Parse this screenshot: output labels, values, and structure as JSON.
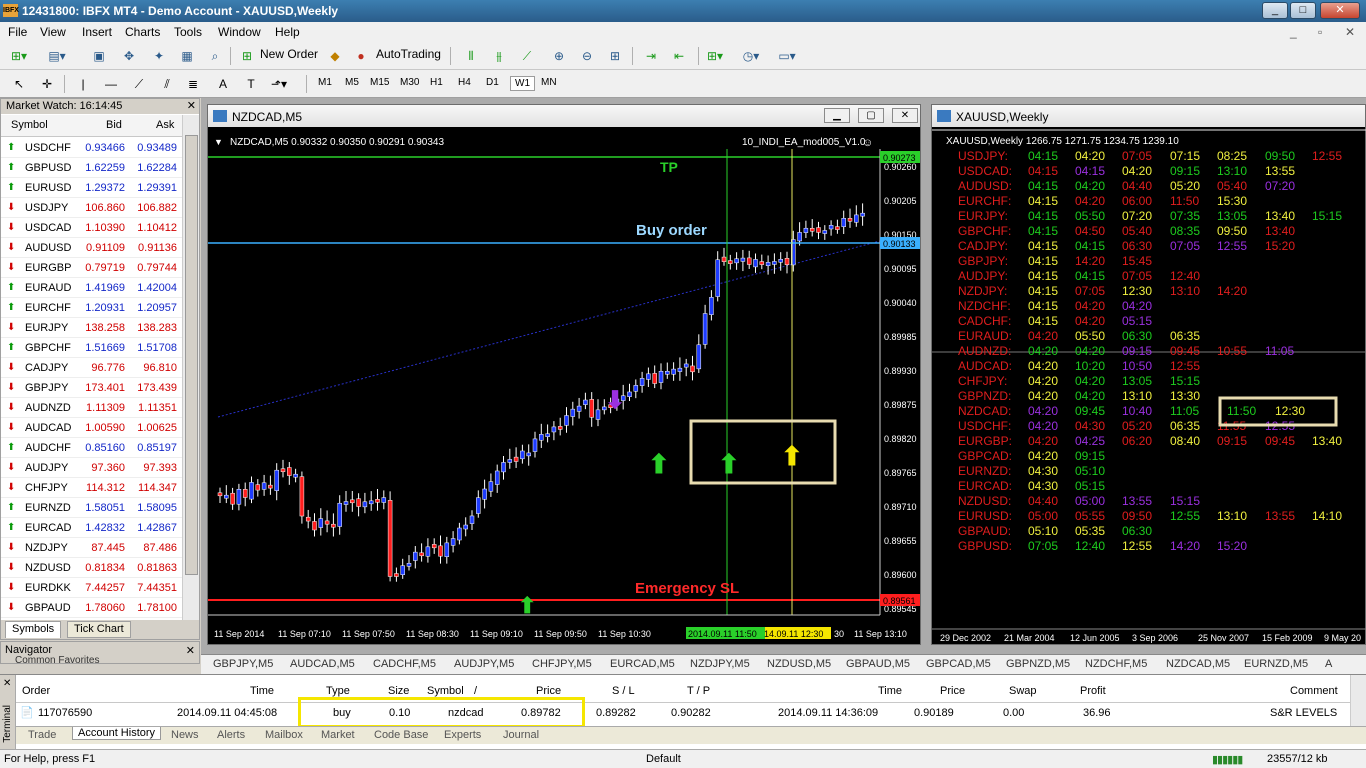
{
  "window": {
    "title": "12431800: IBFX MT4 - Demo Account - XAUUSD,Weekly",
    "logo": "IBFX"
  },
  "menu": [
    "File",
    "View",
    "Insert",
    "Charts",
    "Tools",
    "Window",
    "Help"
  ],
  "toolbar": {
    "new_order": "New Order",
    "autotrading": "AutoTrading"
  },
  "timeframes": [
    "M1",
    "M5",
    "M15",
    "M30",
    "H1",
    "H4",
    "D1",
    "W1",
    "MN"
  ],
  "market_watch": {
    "title": "Market Watch: 16:14:45",
    "col_symbol": "Symbol",
    "col_bid": "Bid",
    "col_ask": "Ask",
    "rows": [
      {
        "s": "USDCHF",
        "b": "0.93466",
        "a": "0.93489",
        "d": "up"
      },
      {
        "s": "GBPUSD",
        "b": "1.62259",
        "a": "1.62284",
        "d": "up"
      },
      {
        "s": "EURUSD",
        "b": "1.29372",
        "a": "1.29391",
        "d": "up"
      },
      {
        "s": "USDJPY",
        "b": "106.860",
        "a": "106.882",
        "d": "dn"
      },
      {
        "s": "USDCAD",
        "b": "1.10390",
        "a": "1.10412",
        "d": "dn"
      },
      {
        "s": "AUDUSD",
        "b": "0.91109",
        "a": "0.91136",
        "d": "dn"
      },
      {
        "s": "EURGBP",
        "b": "0.79719",
        "a": "0.79744",
        "d": "dn"
      },
      {
        "s": "EURAUD",
        "b": "1.41969",
        "a": "1.42004",
        "d": "up"
      },
      {
        "s": "EURCHF",
        "b": "1.20931",
        "a": "1.20957",
        "d": "up"
      },
      {
        "s": "EURJPY",
        "b": "138.258",
        "a": "138.283",
        "d": "dn"
      },
      {
        "s": "GBPCHF",
        "b": "1.51669",
        "a": "1.51708",
        "d": "up"
      },
      {
        "s": "CADJPY",
        "b": "96.776",
        "a": "96.810",
        "d": "dn"
      },
      {
        "s": "GBPJPY",
        "b": "173.401",
        "a": "173.439",
        "d": "dn"
      },
      {
        "s": "AUDNZD",
        "b": "1.11309",
        "a": "1.11351",
        "d": "dn"
      },
      {
        "s": "AUDCAD",
        "b": "1.00590",
        "a": "1.00625",
        "d": "dn"
      },
      {
        "s": "AUDCHF",
        "b": "0.85160",
        "a": "0.85197",
        "d": "up"
      },
      {
        "s": "AUDJPY",
        "b": "97.360",
        "a": "97.393",
        "d": "dn"
      },
      {
        "s": "CHFJPY",
        "b": "114.312",
        "a": "114.347",
        "d": "dn"
      },
      {
        "s": "EURNZD",
        "b": "1.58051",
        "a": "1.58095",
        "d": "up"
      },
      {
        "s": "EURCAD",
        "b": "1.42832",
        "a": "1.42867",
        "d": "up"
      },
      {
        "s": "NZDJPY",
        "b": "87.445",
        "a": "87.486",
        "d": "dn"
      },
      {
        "s": "NZDUSD",
        "b": "0.81834",
        "a": "0.81863",
        "d": "dn"
      },
      {
        "s": "EURDKK",
        "b": "7.44257",
        "a": "7.44351",
        "d": "dn"
      },
      {
        "s": "GBPAUD",
        "b": "1.78060",
        "a": "1.78100",
        "d": "dn"
      }
    ],
    "tab_symbols": "Symbols",
    "tab_tick": "Tick Chart"
  },
  "navigator": {
    "title": "Navigator",
    "tabs": "Common   Favorites"
  },
  "chart1": {
    "title": "NZDCAD,M5",
    "info": "NZDCAD,M5  0.90332 0.90350 0.90291 0.90343",
    "ea": "10_INDI_EA_mod005_V1.0",
    "tp_label": "TP",
    "buy_label": "Buy order",
    "sl_label": "Emergency SL",
    "tp_price": "0.90273",
    "buy_price": "0.90133",
    "sl_price": "0.89561",
    "price_ticks": [
      "0.90260",
      "0.90205",
      "0.90150",
      "0.90095",
      "0.90040",
      "0.89985",
      "0.89930",
      "0.89875",
      "0.89820",
      "0.89765",
      "0.89710",
      "0.89655",
      "0.89600",
      "0.89545"
    ],
    "time_ticks": [
      "11 Sep 2014",
      "11 Sep 07:10",
      "11 Sep 07:50",
      "11 Sep 08:30",
      "11 Sep 09:10",
      "11 Sep 09:50",
      "11 Sep 10:30",
      "2014.09.11 11:50",
      "14.09.11 12:30",
      "30",
      "11 Sep 13:10"
    ],
    "colors": {
      "up": "#1e3cff",
      "down": "#ff1e1e",
      "tp": "#2ad02a",
      "buy": "#3ab0ff",
      "sl": "#ff1e1e",
      "box": "#e8dcb0"
    }
  },
  "chart2": {
    "title": "XAUUSD,Weekly",
    "info": "XAUUSD,Weekly  1266.75 1271.75 1234.75 1239.10",
    "time_ticks": [
      "29 Dec 2002",
      "21 Mar 2004",
      "12 Jun 2005",
      "3 Sep 2006",
      "25 Nov 2007",
      "15 Feb 2009",
      "9 May 20"
    ],
    "grid": [
      {
        "p": "USDJPY:",
        "t": [
          [
            "04:15",
            "g"
          ],
          [
            "04:20",
            "y"
          ],
          [
            "07:05",
            "r"
          ],
          [
            "07:15",
            "y"
          ],
          [
            "08:25",
            "y"
          ],
          [
            "09:50",
            "g"
          ],
          [
            "12:55",
            "r"
          ]
        ]
      },
      {
        "p": "USDCAD:",
        "t": [
          [
            "04:15",
            "r"
          ],
          [
            "04:15",
            "m"
          ],
          [
            "04:20",
            "y"
          ],
          [
            "09:15",
            "g"
          ],
          [
            "13:10",
            "g"
          ],
          [
            "13:55",
            "y"
          ]
        ]
      },
      {
        "p": "AUDUSD:",
        "t": [
          [
            "04:15",
            "g"
          ],
          [
            "04:20",
            "g"
          ],
          [
            "04:40",
            "r"
          ],
          [
            "05:20",
            "y"
          ],
          [
            "05:40",
            "r"
          ],
          [
            "07:20",
            "m"
          ]
        ]
      },
      {
        "p": "EURCHF:",
        "t": [
          [
            "04:15",
            "y"
          ],
          [
            "04:20",
            "r"
          ],
          [
            "06:00",
            "r"
          ],
          [
            "11:50",
            "r"
          ],
          [
            "15:30",
            "y"
          ]
        ]
      },
      {
        "p": "EURJPY:",
        "t": [
          [
            "04:15",
            "g"
          ],
          [
            "05:50",
            "g"
          ],
          [
            "07:20",
            "y"
          ],
          [
            "07:35",
            "g"
          ],
          [
            "13:05",
            "g"
          ],
          [
            "13:40",
            "y"
          ],
          [
            "15:15",
            "g"
          ]
        ]
      },
      {
        "p": "GBPCHF:",
        "t": [
          [
            "04:15",
            "g"
          ],
          [
            "04:50",
            "r"
          ],
          [
            "05:40",
            "r"
          ],
          [
            "08:35",
            "g"
          ],
          [
            "09:50",
            "y"
          ],
          [
            "13:40",
            "r"
          ]
        ]
      },
      {
        "p": "CADJPY:",
        "t": [
          [
            "04:15",
            "y"
          ],
          [
            "04:15",
            "g"
          ],
          [
            "06:30",
            "r"
          ],
          [
            "07:05",
            "m"
          ],
          [
            "12:55",
            "m"
          ],
          [
            "15:20",
            "r"
          ]
        ]
      },
      {
        "p": "GBPJPY:",
        "t": [
          [
            "04:15",
            "y"
          ],
          [
            "14:20",
            "r"
          ],
          [
            "15:45",
            "r"
          ]
        ]
      },
      {
        "p": "AUDJPY:",
        "t": [
          [
            "04:15",
            "y"
          ],
          [
            "04:15",
            "g"
          ],
          [
            "07:05",
            "r"
          ],
          [
            "12:40",
            "r"
          ]
        ]
      },
      {
        "p": "NZDJPY:",
        "t": [
          [
            "04:15",
            "y"
          ],
          [
            "07:05",
            "r"
          ],
          [
            "12:30",
            "y"
          ],
          [
            "13:10",
            "r"
          ],
          [
            "14:20",
            "r"
          ]
        ]
      },
      {
        "p": "NZDCHF:",
        "t": [
          [
            "04:15",
            "y"
          ],
          [
            "04:20",
            "r"
          ],
          [
            "04:20",
            "m"
          ]
        ]
      },
      {
        "p": "CADCHF:",
        "t": [
          [
            "04:15",
            "y"
          ],
          [
            "04:20",
            "r"
          ],
          [
            "05:15",
            "m"
          ]
        ]
      },
      {
        "p": "EURAUD:",
        "t": [
          [
            "04:20",
            "r"
          ],
          [
            "05:50",
            "y"
          ],
          [
            "06:30",
            "g"
          ],
          [
            "06:35",
            "y"
          ]
        ]
      },
      {
        "p": "AUDNZD:",
        "t": [
          [
            "04:20",
            "g"
          ],
          [
            "04:20",
            "g"
          ],
          [
            "09:15",
            "m"
          ],
          [
            "09:45",
            "r"
          ],
          [
            "10:55",
            "r"
          ],
          [
            "11:05",
            "m"
          ]
        ]
      },
      {
        "p": "AUDCAD:",
        "t": [
          [
            "04:20",
            "y"
          ],
          [
            "10:20",
            "g"
          ],
          [
            "10:50",
            "m"
          ],
          [
            "12:55",
            "r"
          ]
        ]
      },
      {
        "p": "CHFJPY:",
        "t": [
          [
            "04:20",
            "y"
          ],
          [
            "04:20",
            "g"
          ],
          [
            "13:05",
            "g"
          ],
          [
            "15:15",
            "g"
          ]
        ]
      },
      {
        "p": "GBPNZD:",
        "t": [
          [
            "04:20",
            "y"
          ],
          [
            "04:20",
            "g"
          ],
          [
            "13:10",
            "y"
          ],
          [
            "13:30",
            "y"
          ]
        ]
      },
      {
        "p": "NZDCAD:",
        "t": [
          [
            "04:20",
            "m"
          ],
          [
            "09:45",
            "g"
          ],
          [
            "10:40",
            "m"
          ],
          [
            "11:05",
            "g"
          ],
          [
            "11:50",
            "g"
          ],
          [
            "12:30",
            "y"
          ]
        ]
      },
      {
        "p": "USDCHF:",
        "t": [
          [
            "04:20",
            "m"
          ],
          [
            "04:30",
            "r"
          ],
          [
            "05:20",
            "r"
          ],
          [
            "06:35",
            "y"
          ],
          [
            "11:55",
            "r"
          ],
          [
            "12:55",
            "m"
          ]
        ]
      },
      {
        "p": "EURGBP:",
        "t": [
          [
            "04:20",
            "r"
          ],
          [
            "04:25",
            "m"
          ],
          [
            "06:20",
            "r"
          ],
          [
            "08:40",
            "y"
          ],
          [
            "09:15",
            "r"
          ],
          [
            "09:45",
            "r"
          ],
          [
            "13:40",
            "y"
          ]
        ]
      },
      {
        "p": "GBPCAD:",
        "t": [
          [
            "04:20",
            "y"
          ],
          [
            "09:15",
            "g"
          ]
        ]
      },
      {
        "p": "EURNZD:",
        "t": [
          [
            "04:30",
            "y"
          ],
          [
            "05:10",
            "g"
          ]
        ]
      },
      {
        "p": "EURCAD:",
        "t": [
          [
            "04:30",
            "y"
          ],
          [
            "05:15",
            "g"
          ]
        ]
      },
      {
        "p": "NZDUSD:",
        "t": [
          [
            "04:40",
            "r"
          ],
          [
            "05:00",
            "m"
          ],
          [
            "13:55",
            "m"
          ],
          [
            "15:15",
            "m"
          ]
        ]
      },
      {
        "p": "EURUSD:",
        "t": [
          [
            "05:00",
            "r"
          ],
          [
            "05:55",
            "r"
          ],
          [
            "09:50",
            "r"
          ],
          [
            "12:55",
            "g"
          ],
          [
            "13:10",
            "y"
          ],
          [
            "13:55",
            "r"
          ],
          [
            "14:10",
            "y"
          ]
        ]
      },
      {
        "p": "GBPAUD:",
        "t": [
          [
            "05:10",
            "y"
          ],
          [
            "05:35",
            "y"
          ],
          [
            "06:30",
            "g"
          ]
        ]
      },
      {
        "p": "GBPUSD:",
        "t": [
          [
            "07:05",
            "g"
          ],
          [
            "12:40",
            "g"
          ],
          [
            "12:55",
            "y"
          ],
          [
            "14:20",
            "m"
          ],
          [
            "15:20",
            "m"
          ]
        ]
      }
    ],
    "palette": {
      "g": "#1ecc1e",
      "y": "#f0f040",
      "r": "#e01e1e",
      "m": "#9b30e0",
      "pair": "#e01e1e"
    }
  },
  "chart_tabs": [
    "GBPJPY,M5",
    "AUDCAD,M5",
    "CADCHF,M5",
    "AUDJPY,M5",
    "CHFJPY,M5",
    "EURCAD,M5",
    "NZDJPY,M5",
    "NZDUSD,M5",
    "GBPAUD,M5",
    "GBPCAD,M5",
    "GBPNZD,M5",
    "NZDCHF,M5",
    "NZDCAD,M5",
    "EURNZD,M5",
    "A"
  ],
  "terminal": {
    "label": "Terminal",
    "headers": {
      "order": "Order",
      "time": "Time",
      "type": "Type",
      "size": "Size",
      "symbol": "Symbol",
      "sort": "/",
      "price": "Price",
      "sl": "S / L",
      "tp": "T / P",
      "ctime": "Time",
      "cprice": "Price",
      "swap": "Swap",
      "profit": "Profit",
      "comment": "Comment"
    },
    "row": {
      "order": "117076590",
      "time": "2014.09.11 04:45:08",
      "type": "buy",
      "size": "0.10",
      "symbol": "nzdcad",
      "price": "0.89782",
      "sl": "0.89282",
      "tp": "0.90282",
      "ctime": "2014.09.11 14:36:09",
      "cprice": "0.90189",
      "swap": "0.00",
      "profit": "36.96",
      "comment": "S&R LEVELS"
    },
    "tabs": [
      "Trade",
      "Account History",
      "News",
      "Alerts",
      "Mailbox",
      "Market",
      "Code Base",
      "Experts",
      "Journal"
    ]
  },
  "status": {
    "help": "For Help, press F1",
    "profile": "Default",
    "traffic": "23557/12 kb"
  }
}
